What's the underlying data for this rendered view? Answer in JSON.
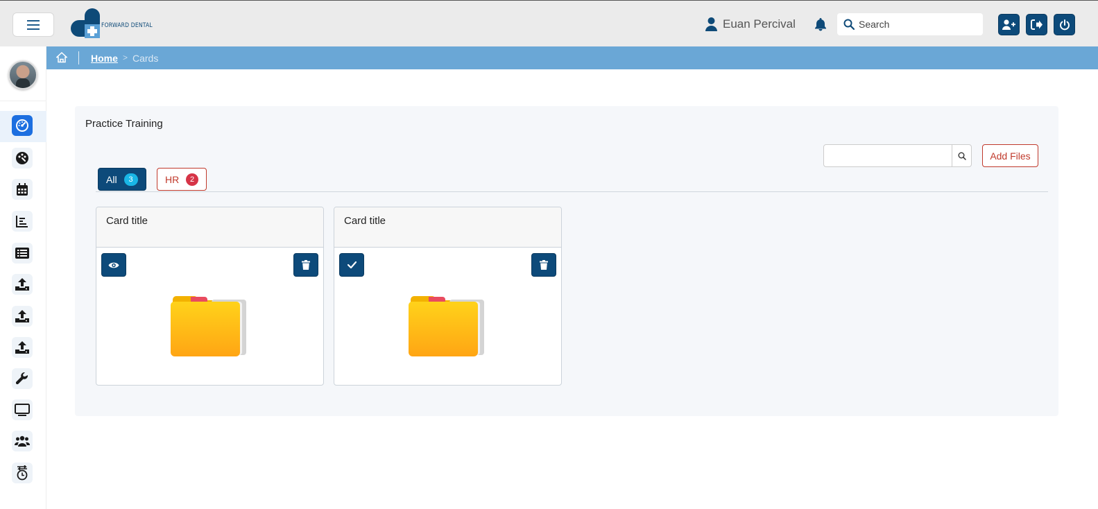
{
  "header": {
    "brand": "FORWARD DENTAL",
    "user_name": "Euan Percival",
    "search_placeholder": "Search",
    "icons": [
      "menu-icon",
      "user-icon",
      "bell-icon",
      "search-icon",
      "add-user-icon",
      "sign-out-icon",
      "power-icon"
    ]
  },
  "sidebar": {
    "items": [
      {
        "name": "dashboard",
        "icon": "gauge-icon",
        "active": true
      },
      {
        "name": "palette",
        "icon": "palette-icon"
      },
      {
        "name": "calendar",
        "icon": "calendar-icon"
      },
      {
        "name": "reports",
        "icon": "chart-icon"
      },
      {
        "name": "list",
        "icon": "list-icon"
      },
      {
        "name": "upload-1",
        "icon": "upload-icon"
      },
      {
        "name": "upload-2",
        "icon": "upload-icon"
      },
      {
        "name": "upload-3",
        "icon": "upload-icon"
      },
      {
        "name": "tools",
        "icon": "wrench-icon"
      },
      {
        "name": "monitor",
        "icon": "monitor-icon"
      },
      {
        "name": "users",
        "icon": "users-icon"
      },
      {
        "name": "history",
        "icon": "history-icon"
      }
    ]
  },
  "breadcrumb": {
    "home": "Home",
    "current": "Cards"
  },
  "panel": {
    "title": "Practice Training",
    "add_files_label": "Add Files",
    "tabs": [
      {
        "label": "All",
        "count": "3"
      },
      {
        "label": "HR",
        "count": "2"
      }
    ],
    "cards": [
      {
        "title": "Card title",
        "action": "view"
      },
      {
        "title": "Card title",
        "action": "check"
      }
    ]
  },
  "colors": {
    "primary": "#0d4a7a",
    "breadcrumb_bg": "#6aa7d6",
    "danger": "#c0392b",
    "info_badge": "#19b6e6",
    "active_sidebar": "#1d6fe0"
  }
}
